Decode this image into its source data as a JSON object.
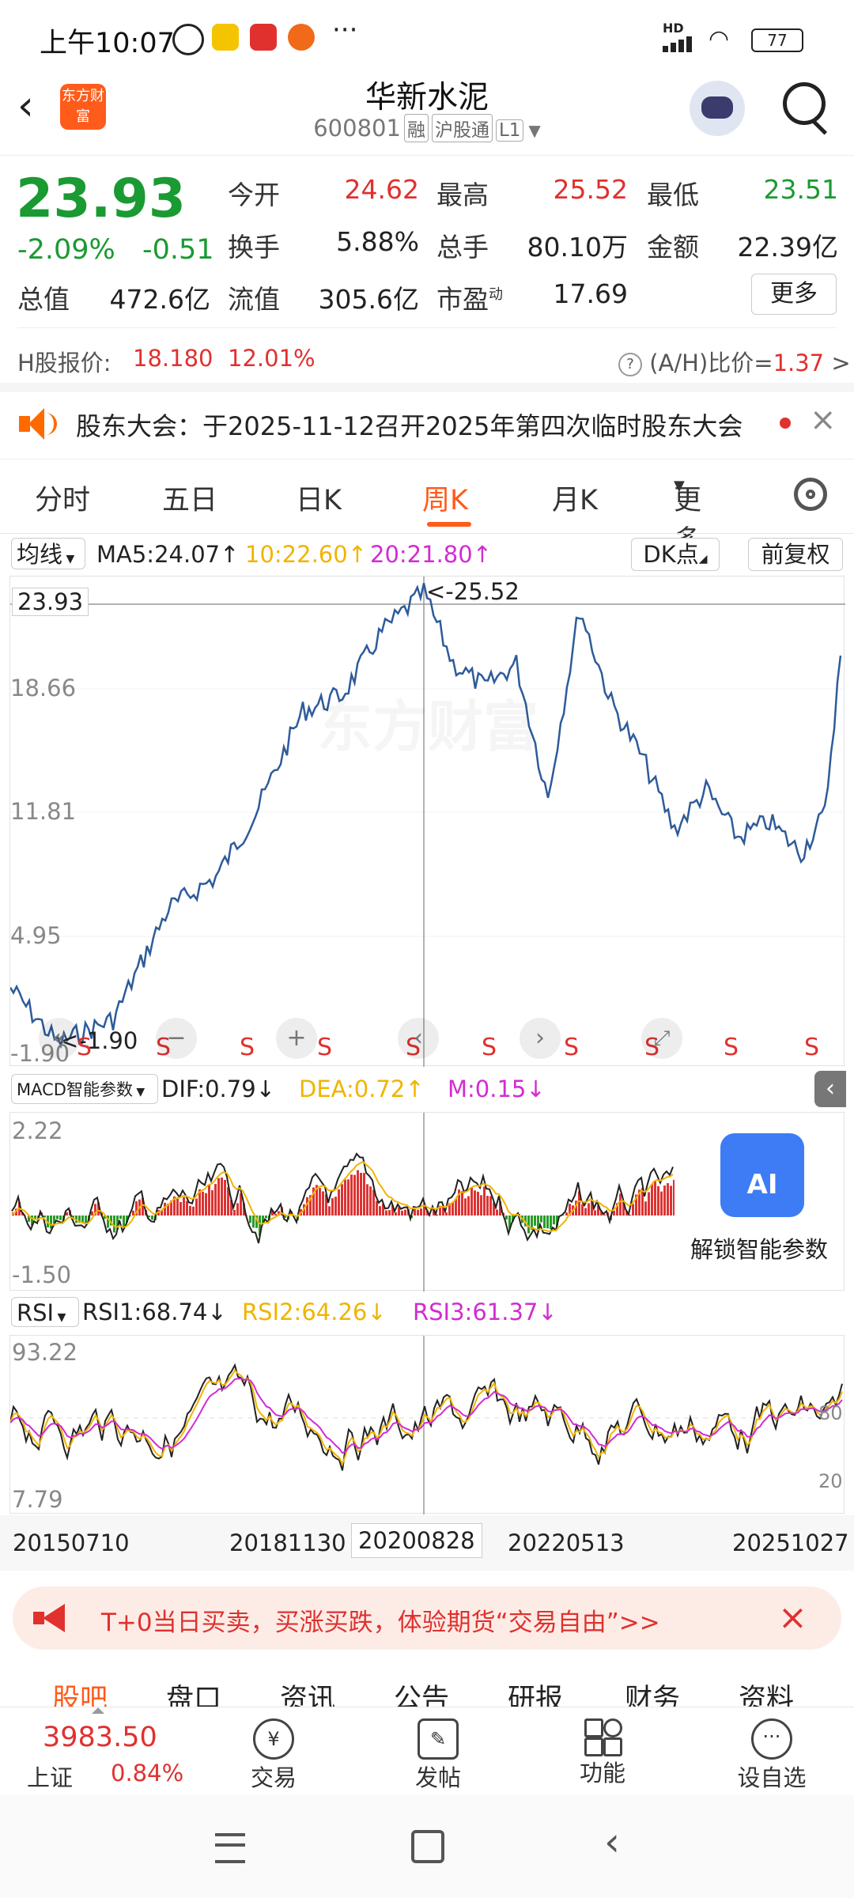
{
  "status_bar": {
    "time": "上午10:07",
    "network": "HD",
    "battery": "77"
  },
  "header": {
    "title": "华新水泥",
    "code": "600801",
    "tags": [
      "融",
      "沪股通",
      "L1"
    ],
    "brand": "东方财富"
  },
  "quote": {
    "price": "23.93",
    "change_pct": "-2.09%",
    "change": "-0.51",
    "fields": [
      {
        "label": "今开",
        "value": "24.62",
        "color": "red"
      },
      {
        "label": "最高",
        "value": "25.52",
        "color": "red"
      },
      {
        "label": "最低",
        "value": "23.51",
        "color": "green"
      },
      {
        "label": "换手",
        "value": "5.88%",
        "color": "black"
      },
      {
        "label": "总手",
        "value": "80.10万",
        "color": "black"
      },
      {
        "label": "金额",
        "value": "22.39亿",
        "color": "black"
      },
      {
        "label": "总值",
        "value": "472.6亿",
        "color": "black"
      },
      {
        "label": "流值",
        "value": "305.6亿",
        "color": "black"
      },
      {
        "label": "市盈",
        "value": "17.69",
        "color": "black"
      }
    ],
    "pe_superscript": "动",
    "more_label": "更多"
  },
  "h_share": {
    "label": "H股报价:",
    "price": "18.180",
    "premium": "12.01%",
    "ratio_label": "(A/H)比价=",
    "ratio_value": "1.37",
    "arrow": ">"
  },
  "notice": {
    "text": "股东大会：于2025-11-12召开2025年第四次临时股东大会"
  },
  "tabs": {
    "items": [
      "分时",
      "五日",
      "日K",
      "周K",
      "月K",
      "更多"
    ],
    "active": "周K"
  },
  "indicators": {
    "ma_selector": "均线",
    "ma5": "MA5:24.07",
    "ma10": "10:22.60",
    "ma20": "20:21.80",
    "dk_label": "DK点",
    "fq_label": "前复权"
  },
  "price_chart": {
    "current_price_label": "23.93",
    "high_marker": "<-25.52",
    "low_marker": "<-1.90",
    "y_ticks": [
      "18.66",
      "11.81",
      "4.95",
      "-1.90"
    ],
    "watermark": "东方财富",
    "signal_label": "S"
  },
  "macd": {
    "selector": "MACD智能参数",
    "dif": "DIF:0.79",
    "dea": "DEA:0.72",
    "m": "M:0.15",
    "y_top": "2.22",
    "y_bottom": "-1.50",
    "ai_badge": "AI",
    "ai_label": "解锁智能参数"
  },
  "rsi": {
    "selector": "RSI",
    "rsi1": "RSI1:68.74",
    "rsi2": "RSI2:64.26",
    "rsi3": "RSI3:61.37",
    "y_top": "93.22",
    "y_bottom": "7.79",
    "level_80": "80",
    "level_20": "20"
  },
  "x_axis": {
    "ticks": [
      "20150710",
      "20181130",
      "20200828",
      "20220513",
      "20251027"
    ]
  },
  "promo": {
    "text": "T+0当日买卖，买涨买跌，体验期货“交易自由”>>"
  },
  "sub_tabs": [
    "股吧",
    "盘口",
    "资讯",
    "公告",
    "研报",
    "财务",
    "资料"
  ],
  "bottom_nav": {
    "index_price": "3983.50",
    "index_name": "上证",
    "index_change": "0.84%",
    "items": [
      "交易",
      "发帖",
      "功能",
      "设自选"
    ]
  },
  "colors": {
    "accent": "#e0312f",
    "green": "#1a9a32",
    "orange": "#ff6a00",
    "line": "#2e5b9a",
    "yellow": "#f0b400",
    "magenta": "#d22cd2"
  }
}
